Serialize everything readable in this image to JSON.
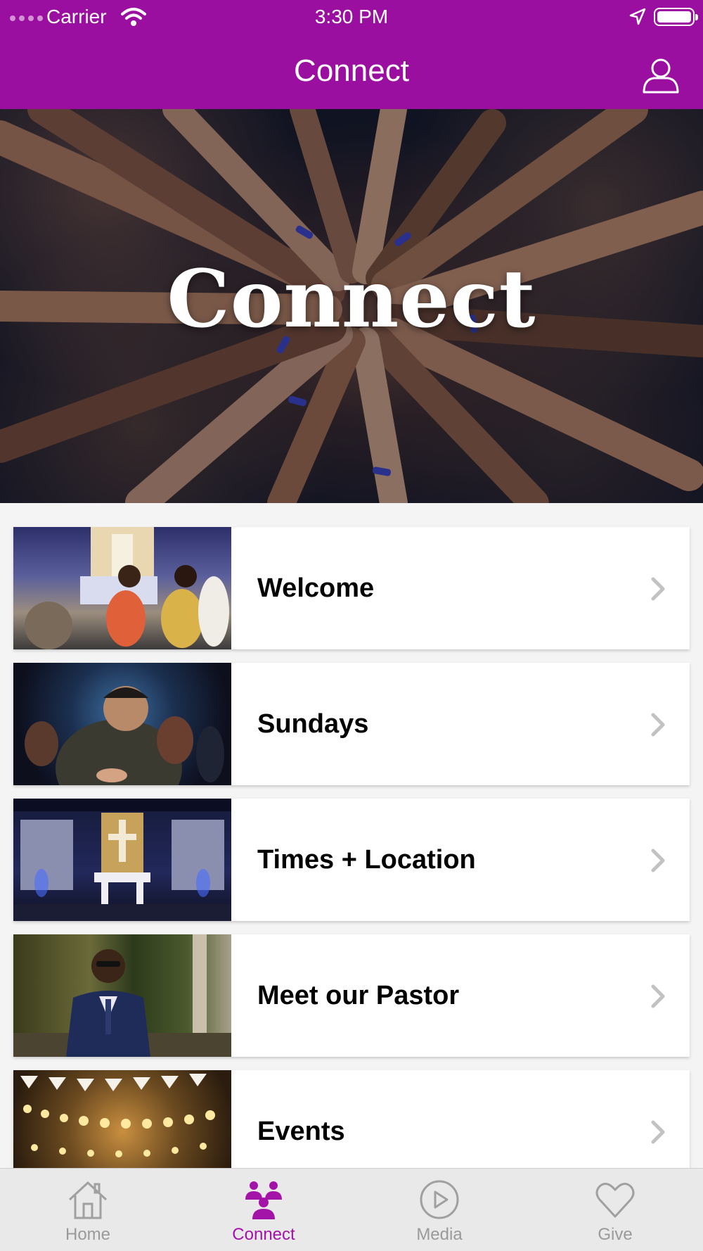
{
  "status_bar": {
    "carrier": "Carrier",
    "time": "3:30 PM",
    "icons": [
      "signal-dots-icon",
      "wifi-icon",
      "location-arrow-icon",
      "battery-icon"
    ]
  },
  "header": {
    "title": "Connect",
    "profile_icon": "user-profile-icon",
    "background_color": "#9b0fa0"
  },
  "hero": {
    "title": "Connect"
  },
  "list": {
    "items": [
      {
        "label": "Welcome"
      },
      {
        "label": "Sundays"
      },
      {
        "label": "Times + Location"
      },
      {
        "label": "Meet our Pastor"
      },
      {
        "label": "Events"
      }
    ]
  },
  "tabbar": {
    "active_color": "#a413a8",
    "inactive_color": "#9a9a9a",
    "tabs": [
      {
        "label": "Home",
        "icon": "home-icon"
      },
      {
        "label": "Connect",
        "icon": "people-group-icon"
      },
      {
        "label": "Media",
        "icon": "play-circle-icon"
      },
      {
        "label": "Give",
        "icon": "heart-icon"
      }
    ]
  }
}
